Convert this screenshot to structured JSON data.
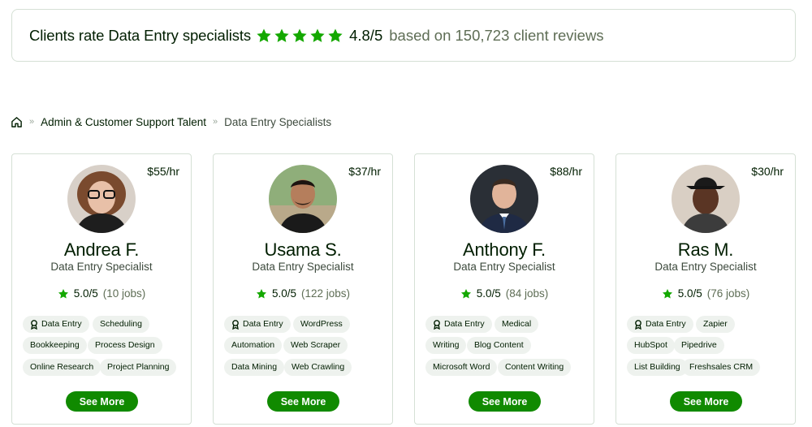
{
  "banner": {
    "lead": "Clients rate Data Entry specialists",
    "rating_value": 4.8,
    "star_count": 5,
    "score": "4.8/5",
    "based_on": "based on 150,723 client reviews",
    "star_color": "#14a800"
  },
  "breadcrumb": {
    "home_icon": "home-icon",
    "items": [
      "Admin & Customer Support Talent",
      "Data Entry Specialists"
    ],
    "separator": "»"
  },
  "cards": [
    {
      "rate": "$55/hr",
      "name": "Andrea F.",
      "title": "Data Entry Specialist",
      "score": "5.0/5",
      "jobs": "(10 jobs)",
      "skills": [
        "Data Entry",
        "Scheduling",
        "Bookkeeping",
        "Process Design",
        "Online Research",
        "Project Planning"
      ],
      "button": "See More"
    },
    {
      "rate": "$37/hr",
      "name": "Usama S.",
      "title": "Data Entry Specialist",
      "score": "5.0/5",
      "jobs": "(122 jobs)",
      "skills": [
        "Data Entry",
        "WordPress",
        "Automation",
        "Web Scraper",
        "Data Mining",
        "Web Crawling"
      ],
      "button": "See More"
    },
    {
      "rate": "$88/hr",
      "name": "Anthony F.",
      "title": "Data Entry Specialist",
      "score": "5.0/5",
      "jobs": "(84 jobs)",
      "skills": [
        "Data Entry",
        "Medical",
        "Writing",
        "Blog Content",
        "Microsoft Word",
        "Content Writing"
      ],
      "button": "See More"
    },
    {
      "rate": "$30/hr",
      "name": "Ras M.",
      "title": "Data Entry Specialist",
      "score": "5.0/5",
      "jobs": "(76 jobs)",
      "skills": [
        "Data Entry",
        "Zapier",
        "HubSpot",
        "Pipedrive",
        "List Building",
        "Freshsales CRM"
      ],
      "button": "See More"
    }
  ],
  "colors": {
    "brand_green": "#108a00",
    "star_green": "#14a800",
    "pill_bg": "#eef2ee"
  }
}
